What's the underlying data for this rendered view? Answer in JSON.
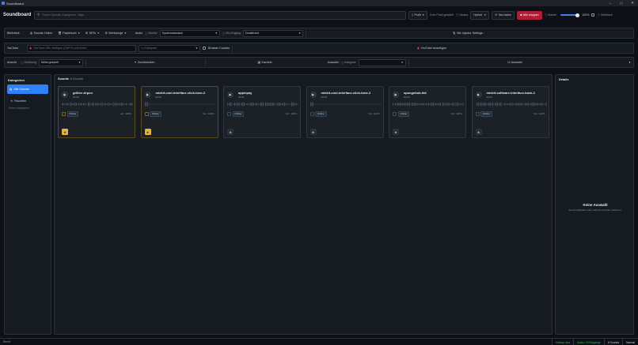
{
  "window": {
    "title": "Soundboard",
    "min": "–",
    "max": "□",
    "close": "✕"
  },
  "header": {
    "brand": "Soundboard",
    "search_placeholder": "Suche Sounds, Kategorien, Tags...",
    "profile_label": "Profil",
    "no_profile": "Kein Profil gewählt",
    "modus_label": "Modus",
    "modus_value": "Hybrid",
    "reload": "Neu laden",
    "stop_all": "Alle stoppen",
    "master_label": "Master",
    "master_value": "100%",
    "mehrfach_label": "Mehrfach"
  },
  "row1": {
    "label": "Bibliothek",
    "sounds_online": "Sounds Online",
    "papierkorb": "Papierkorb",
    "sets": "SETs",
    "werkzeuge": "Werkzeuge",
    "audio_label": "Audio",
    "monitor_label": "Monitor",
    "monitor_value": "Systemstandard",
    "mic_label": "Mic-Eingang",
    "mic_value": "Deaktiviert",
    "mic_injector": "Mic Injector Settings..."
  },
  "row2": {
    "label": "YouTube",
    "url_placeholder": "YouTube URL einfügen (Ctrl+V) und Enter",
    "kategorie_label": "Kategorie",
    "browser_cookies": "Browser Cookies",
    "add_youtube": "YouTube hinzufügen"
  },
  "row3": {
    "label": "Ansicht",
    "sortierung_label": "Sortierung",
    "sort_value": "Meist gespielt",
    "zuruecksetzen": "Zurücksetzen",
    "kachein": "Kacheln",
    "auswahl_label": "Auswahl",
    "auswahl_kategorie_label": "Kategorie",
    "auswahl_btn": "Auswahl"
  },
  "sidebar": {
    "title": "Kategorien",
    "all": "Alle Sounds",
    "favoriten": "Favoriten",
    "none": "Keine Kategorien"
  },
  "main": {
    "title": "Sounds",
    "count": "6 Sounds"
  },
  "cards": [
    {
      "name": "grillen zirpen",
      "duration": "00:06",
      "output": "Online",
      "volume": "Vol.: 100%",
      "favorite": true
    },
    {
      "name": "mixkit-cool-interface-click-tone-2",
      "duration": "00:00",
      "output": "Online",
      "volume": "Vol.: 100%",
      "favorite": true
    },
    {
      "name": "applepay",
      "duration": "00:01",
      "output": "Online",
      "volume": "Vol.: 100%",
      "favorite": false
    },
    {
      "name": "mixkit-cool-interface-click-tone-2",
      "duration": "00:00",
      "output": "Online",
      "volume": "Vol.: 100%",
      "favorite": false
    },
    {
      "name": "spongebob-fail",
      "duration": "00:03",
      "output": "Online",
      "volume": "Vol.: 100%",
      "favorite": false
    },
    {
      "name": "mixkit-software-interface-back-2",
      "duration": "00:01",
      "output": "Online",
      "volume": "Vol.: 100%",
      "favorite": false
    }
  ],
  "details": {
    "title": "Details",
    "empty_title": "Keine Auswahl",
    "empty_sub": "Sound anklicken oder mehrere Sounds markieren."
  },
  "status": {
    "left": "Bereit",
    "hotkey": "Hotkey: Aus",
    "audio": "Audio: 15 Eingänge",
    "sounds": "6 Sounds",
    "mode": "Normal"
  },
  "colors": {
    "accent": "#2f81f7",
    "stop": "#b01e35",
    "favorite": "#e3b341",
    "ok": "#3fb950"
  }
}
